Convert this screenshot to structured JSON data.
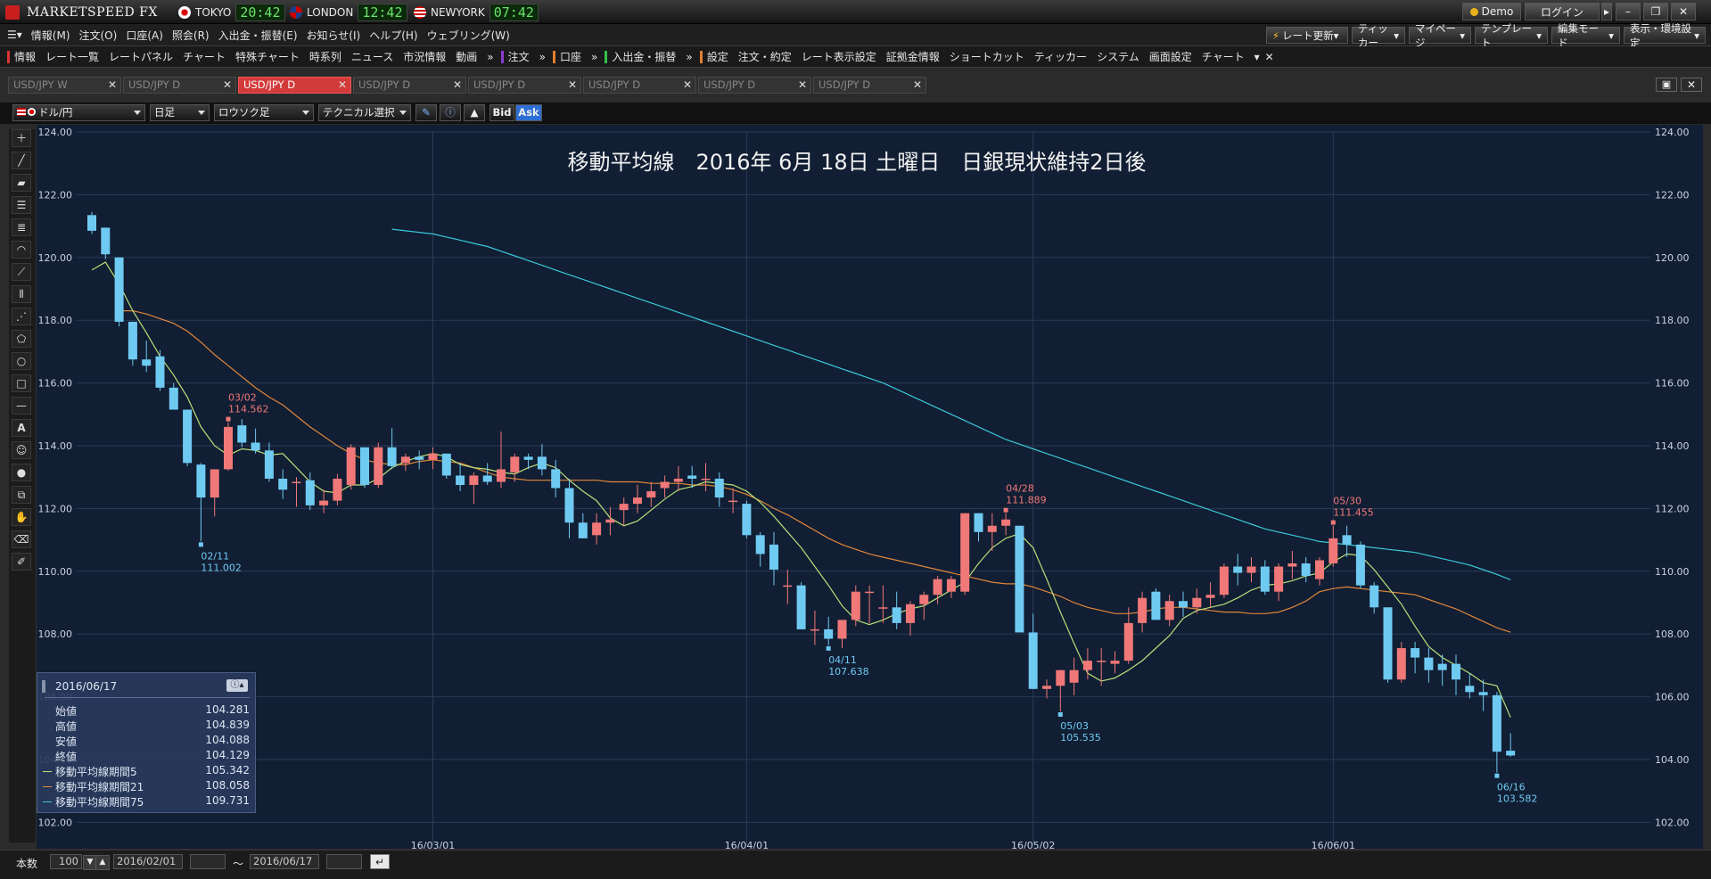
{
  "titlebar": {
    "app_name": "MARKETSPEED FX",
    "cities": [
      {
        "name": "TOKYO",
        "time": "20:42",
        "flag": "jp"
      },
      {
        "name": "LONDON",
        "time": "12:42",
        "flag": "uk"
      },
      {
        "name": "NEWYORK",
        "time": "07:42",
        "flag": "us"
      }
    ],
    "demo_label": "Demo",
    "login_label": "ログイン"
  },
  "menubar": {
    "items": [
      "情報(M)",
      "注文(O)",
      "口座(A)",
      "照会(R)",
      "入出金・振替(E)",
      "お知らせ(I)",
      "ヘルプ(H)",
      "ウェブリング(W)"
    ],
    "right_items": [
      "レート更新",
      "ティッカー",
      "マイページ",
      "テンプレート",
      "編集モード",
      "表示・環境設定"
    ]
  },
  "toolbar": {
    "group1": [
      "情報",
      "レート一覧",
      "レートパネル",
      "チャート",
      "特殊チャート",
      "時系列",
      "ニュース",
      "市況情報",
      "動画"
    ],
    "order": "注文",
    "account": "口座",
    "transfer": "入出金・振替",
    "group2": [
      "設定",
      "注文・約定",
      "レート表示設定",
      "証拠金情報",
      "ショートカット",
      "ティッカー",
      "システム",
      "画面設定",
      "チャート"
    ]
  },
  "tabs": [
    {
      "label": "USD/JPY W",
      "active": false
    },
    {
      "label": "USD/JPY D",
      "active": false
    },
    {
      "label": "USD/JPY D",
      "active": true
    },
    {
      "label": "USD/JPY D",
      "active": false
    },
    {
      "label": "USD/JPY D",
      "active": false
    },
    {
      "label": "USD/JPY D",
      "active": false
    },
    {
      "label": "USD/JPY D",
      "active": false
    },
    {
      "label": "USD/JPY D",
      "active": false
    }
  ],
  "chart_toolbar": {
    "pair": "ドル/円",
    "period": "日足",
    "chart_style": "ロウソク足",
    "technical": "テクニカル選択",
    "bid": "Bid",
    "ask": "Ask"
  },
  "info_panel": {
    "date": "2016/06/17",
    "rows": [
      {
        "label": "始値",
        "value": "104.281"
      },
      {
        "label": "高値",
        "value": "104.839"
      },
      {
        "label": "安値",
        "value": "104.088"
      },
      {
        "label": "終値",
        "value": "104.129"
      },
      {
        "label": "移動平均線期間5",
        "value": "105.342",
        "color": "#b9e07a"
      },
      {
        "label": "移動平均線期間21",
        "value": "108.058",
        "color": "#e0873a"
      },
      {
        "label": "移動平均線期間75",
        "value": "109.731",
        "color": "#3ac8d8"
      }
    ]
  },
  "footer": {
    "count_label": "本数",
    "count_value": "100",
    "date_from": "2016/02/01",
    "range_sep": "～",
    "date_to": "2016/06/17"
  },
  "colors": {
    "up": "#f07878",
    "down": "#6fcaf2",
    "ma5": "#b9e07a",
    "ma21": "#e0873a",
    "ma75": "#3ac8d8",
    "chart_bg": "#111e33",
    "grid": "#2a3a58"
  },
  "chart_data": {
    "type": "candlestick",
    "title": "移動平均線　2016年 6月 18日 土曜日　日銀現状維持2日後",
    "ylim": [
      101.5,
      124.0
    ],
    "yticks": [
      "124.00",
      "122.00",
      "120.00",
      "118.00",
      "116.00",
      "114.00",
      "112.00",
      "110.00",
      "108.00",
      "106.00",
      "104.00",
      "102.00"
    ],
    "xticks": [
      {
        "label": "16/03/01",
        "index": 25
      },
      {
        "label": "16/04/01",
        "index": 48
      },
      {
        "label": "16/05/02",
        "index": 69
      },
      {
        "label": "16/06/01",
        "index": 91
      }
    ],
    "candles": [
      [
        121.35,
        121.45,
        120.75,
        120.85
      ],
      [
        120.95,
        120.95,
        119.95,
        120.1
      ],
      [
        120.0,
        120.0,
        117.8,
        117.95
      ],
      [
        117.95,
        117.95,
        116.55,
        116.75
      ],
      [
        116.75,
        117.35,
        116.35,
        116.55
      ],
      [
        116.85,
        117.05,
        115.75,
        115.85
      ],
      [
        115.85,
        116.0,
        115.25,
        115.15
      ],
      [
        115.15,
        115.15,
        113.35,
        113.45
      ],
      [
        113.4,
        113.45,
        110.95,
        112.35
      ],
      [
        112.35,
        113.25,
        111.75,
        113.25
      ],
      [
        113.25,
        114.75,
        113.2,
        114.6
      ],
      [
        114.65,
        114.85,
        113.95,
        114.1
      ],
      [
        114.1,
        114.55,
        113.75,
        113.85
      ],
      [
        113.85,
        114.1,
        112.85,
        112.95
      ],
      [
        112.95,
        113.25,
        112.3,
        112.6
      ],
      [
        112.85,
        113.0,
        112.05,
        112.85
      ],
      [
        112.9,
        113.15,
        111.95,
        112.1
      ],
      [
        112.1,
        112.6,
        111.85,
        112.25
      ],
      [
        112.25,
        113.1,
        112.1,
        112.95
      ],
      [
        112.75,
        114.05,
        112.6,
        113.95
      ],
      [
        113.95,
        113.95,
        112.65,
        112.75
      ],
      [
        112.75,
        114.1,
        112.65,
        113.95
      ],
      [
        113.95,
        114.56,
        113.25,
        113.35
      ],
      [
        113.45,
        113.75,
        113.2,
        113.65
      ],
      [
        113.65,
        113.85,
        113.25,
        113.55
      ],
      [
        113.55,
        113.95,
        113.25,
        113.75
      ],
      [
        113.75,
        113.75,
        112.95,
        113.05
      ],
      [
        113.05,
        113.45,
        112.55,
        112.75
      ],
      [
        112.75,
        113.15,
        112.15,
        113.05
      ],
      [
        113.05,
        113.45,
        112.75,
        112.85
      ],
      [
        112.85,
        114.45,
        112.65,
        113.25
      ],
      [
        113.15,
        113.75,
        112.85,
        113.65
      ],
      [
        113.65,
        113.75,
        113.25,
        113.55
      ],
      [
        113.65,
        114.05,
        113.05,
        113.25
      ],
      [
        113.25,
        113.55,
        112.35,
        112.65
      ],
      [
        112.65,
        112.95,
        111.05,
        111.55
      ],
      [
        111.55,
        111.85,
        111.05,
        111.05
      ],
      [
        111.15,
        111.85,
        110.85,
        111.55
      ],
      [
        111.55,
        112.05,
        111.15,
        111.65
      ],
      [
        111.95,
        112.35,
        111.45,
        112.15
      ],
      [
        112.15,
        112.75,
        111.85,
        112.35
      ],
      [
        112.35,
        112.85,
        112.05,
        112.55
      ],
      [
        112.65,
        113.05,
        112.35,
        112.85
      ],
      [
        112.85,
        113.35,
        112.55,
        112.95
      ],
      [
        113.05,
        113.35,
        112.65,
        112.95
      ],
      [
        112.95,
        113.45,
        112.55,
        112.95
      ],
      [
        112.95,
        113.15,
        112.05,
        112.35
      ],
      [
        112.25,
        112.65,
        111.85,
        112.25
      ],
      [
        112.15,
        112.25,
        111.05,
        111.15
      ],
      [
        111.15,
        111.25,
        110.15,
        110.55
      ],
      [
        110.85,
        111.25,
        109.55,
        110.05
      ],
      [
        109.55,
        110.05,
        108.95,
        109.55
      ],
      [
        109.55,
        109.65,
        108.15,
        108.15
      ],
      [
        108.15,
        108.75,
        107.65,
        108.15
      ],
      [
        108.15,
        108.55,
        107.64,
        107.85
      ],
      [
        107.85,
        108.35,
        107.55,
        108.45
      ],
      [
        108.45,
        109.55,
        108.25,
        109.35
      ],
      [
        109.35,
        109.55,
        108.35,
        109.35
      ],
      [
        108.85,
        109.55,
        108.35,
        108.85
      ],
      [
        108.85,
        109.35,
        108.15,
        108.35
      ],
      [
        108.35,
        109.05,
        107.95,
        108.95
      ],
      [
        108.95,
        109.35,
        108.45,
        109.25
      ],
      [
        109.25,
        109.85,
        108.95,
        109.75
      ],
      [
        109.35,
        109.85,
        109.15,
        109.75
      ],
      [
        109.35,
        111.85,
        109.25,
        111.85
      ],
      [
        111.85,
        111.85,
        110.95,
        111.25
      ],
      [
        111.25,
        111.85,
        110.65,
        111.45
      ],
      [
        111.45,
        111.85,
        111.15,
        111.65
      ],
      [
        111.45,
        111.45,
        108.05,
        108.05
      ],
      [
        108.05,
        108.65,
        106.25,
        106.25
      ],
      [
        106.25,
        106.55,
        105.95,
        106.35
      ],
      [
        106.35,
        106.85,
        105.535,
        106.85
      ],
      [
        106.45,
        107.25,
        106.05,
        106.85
      ],
      [
        106.85,
        107.55,
        106.55,
        107.15
      ],
      [
        107.15,
        107.55,
        106.35,
        107.15
      ],
      [
        107.05,
        107.45,
        106.75,
        107.15
      ],
      [
        107.15,
        108.85,
        107.05,
        108.35
      ],
      [
        108.35,
        109.35,
        108.05,
        109.15
      ],
      [
        109.35,
        109.45,
        108.45,
        108.45
      ],
      [
        108.45,
        109.25,
        108.25,
        109.05
      ],
      [
        109.05,
        109.35,
        108.55,
        108.85
      ],
      [
        108.85,
        109.45,
        108.65,
        109.15
      ],
      [
        109.15,
        109.65,
        108.85,
        109.25
      ],
      [
        109.25,
        110.25,
        109.15,
        110.15
      ],
      [
        110.15,
        110.55,
        109.55,
        109.95
      ],
      [
        109.95,
        110.45,
        109.65,
        110.15
      ],
      [
        110.15,
        110.35,
        109.25,
        109.35
      ],
      [
        109.35,
        110.25,
        109.05,
        110.15
      ],
      [
        110.15,
        110.65,
        109.75,
        110.25
      ],
      [
        110.25,
        110.45,
        109.65,
        109.85
      ],
      [
        109.75,
        110.45,
        109.55,
        110.35
      ],
      [
        110.25,
        111.455,
        110.15,
        111.05
      ],
      [
        111.15,
        111.45,
        110.45,
        110.85
      ],
      [
        110.85,
        110.95,
        109.45,
        109.55
      ],
      [
        109.55,
        109.65,
        108.65,
        108.85
      ],
      [
        108.85,
        108.85,
        106.45,
        106.55
      ],
      [
        106.55,
        107.75,
        106.45,
        107.55
      ],
      [
        107.55,
        107.75,
        106.75,
        107.25
      ],
      [
        107.25,
        107.55,
        106.45,
        106.85
      ],
      [
        107.05,
        107.35,
        106.35,
        106.85
      ],
      [
        107.05,
        107.35,
        106.05,
        106.55
      ],
      [
        106.35,
        106.75,
        105.95,
        106.15
      ],
      [
        106.15,
        106.55,
        105.55,
        106.05
      ],
      [
        106.05,
        106.15,
        103.582,
        104.25
      ],
      [
        104.281,
        104.839,
        104.088,
        104.129
      ]
    ],
    "ma5": [
      119.6,
      119.85,
      119.15,
      118.3,
      117.6,
      116.85,
      116.25,
      115.55,
      114.6,
      114.0,
      113.7,
      113.9,
      113.85,
      113.7,
      113.75,
      113.3,
      112.85,
      112.55,
      112.5,
      112.75,
      112.75,
      112.95,
      113.3,
      113.5,
      113.65,
      113.75,
      113.65,
      113.4,
      113.3,
      113.25,
      113.15,
      113.1,
      113.3,
      113.45,
      113.3,
      112.9,
      112.55,
      112.25,
      111.7,
      111.45,
      111.6,
      111.95,
      112.3,
      112.6,
      112.7,
      112.85,
      112.8,
      112.75,
      112.55,
      112.2,
      111.75,
      111.25,
      110.75,
      110.15,
      109.55,
      108.9,
      108.45,
      108.3,
      108.45,
      108.65,
      108.8,
      108.9,
      109.15,
      109.4,
      109.65,
      110.25,
      110.75,
      111.05,
      111.2,
      110.75,
      109.75,
      108.7,
      107.7,
      106.75,
      106.5,
      106.6,
      106.85,
      107.15,
      107.55,
      107.95,
      108.5,
      108.75,
      108.85,
      108.95,
      109.15,
      109.4,
      109.55,
      109.6,
      109.7,
      109.85,
      109.95,
      110.3,
      110.55,
      110.5,
      110.05,
      109.5,
      108.95,
      108.25,
      107.6,
      107.25,
      107.0,
      106.75,
      106.45,
      106.35,
      105.342
    ],
    "ma21": [
      118.3,
      118.3,
      118.2,
      118.05,
      117.9,
      117.65,
      117.3,
      116.9,
      116.55,
      116.2,
      115.85,
      115.55,
      115.3,
      114.95,
      114.6,
      114.3,
      114.0,
      113.75,
      113.55,
      113.45,
      113.4,
      113.4,
      113.5,
      113.55,
      113.5,
      113.45,
      113.3,
      113.15,
      113.0,
      112.95,
      112.9,
      112.9,
      112.9,
      112.9,
      112.9,
      112.9,
      112.85,
      112.85,
      112.85,
      112.8,
      112.8,
      112.8,
      112.75,
      112.75,
      112.7,
      112.6,
      112.45,
      112.25,
      112.0,
      111.8,
      111.55,
      111.3,
      111.05,
      110.85,
      110.7,
      110.55,
      110.45,
      110.35,
      110.25,
      110.15,
      110.05,
      109.95,
      109.85,
      109.75,
      109.65,
      109.6,
      109.6,
      109.5,
      109.35,
      109.2,
      109.0,
      108.85,
      108.75,
      108.65,
      108.65,
      108.7,
      108.8,
      108.85,
      108.85,
      108.8,
      108.75,
      108.7,
      108.7,
      108.65,
      108.65,
      108.7,
      108.85,
      109.05,
      109.35,
      109.45,
      109.5,
      109.45,
      109.4,
      109.35,
      109.3,
      109.25,
      109.1,
      108.95,
      108.8,
      108.6,
      108.4,
      108.2,
      108.058
    ],
    "ma75": [
      120.9,
      120.85,
      120.8,
      120.75,
      120.65,
      120.55,
      120.45,
      120.35,
      120.2,
      120.05,
      119.9,
      119.75,
      119.6,
      119.45,
      119.3,
      119.15,
      119.0,
      118.85,
      118.7,
      118.55,
      118.4,
      118.25,
      118.1,
      117.95,
      117.8,
      117.65,
      117.5,
      117.35,
      117.2,
      117.05,
      116.9,
      116.75,
      116.6,
      116.45,
      116.3,
      116.15,
      116.0,
      115.8,
      115.6,
      115.4,
      115.2,
      115.0,
      114.8,
      114.6,
      114.4,
      114.2,
      114.05,
      113.9,
      113.75,
      113.6,
      113.45,
      113.3,
      113.15,
      113.0,
      112.85,
      112.7,
      112.55,
      112.4,
      112.25,
      112.1,
      111.95,
      111.8,
      111.65,
      111.5,
      111.35,
      111.25,
      111.15,
      111.05,
      110.95,
      110.9,
      110.85,
      110.8,
      110.75,
      110.7,
      110.65,
      110.6,
      110.5,
      110.4,
      110.3,
      110.2,
      110.05,
      109.9,
      109.731
    ],
    "annotations": [
      {
        "index": 10,
        "date": "03/02",
        "price": "114.562",
        "pos": "high"
      },
      {
        "index": 8,
        "date": "02/11",
        "price": "111.002",
        "pos": "low"
      },
      {
        "index": 54,
        "date": "04/11",
        "price": "107.638",
        "pos": "low"
      },
      {
        "index": 67,
        "date": "04/28",
        "price": "111.889",
        "pos": "high"
      },
      {
        "index": 71,
        "date": "05/03",
        "price": "105.535",
        "pos": "low"
      },
      {
        "index": 91,
        "date": "05/30",
        "price": "111.455",
        "pos": "high"
      },
      {
        "index": 103,
        "date": "06/16",
        "price": "103.582",
        "pos": "low"
      }
    ]
  }
}
